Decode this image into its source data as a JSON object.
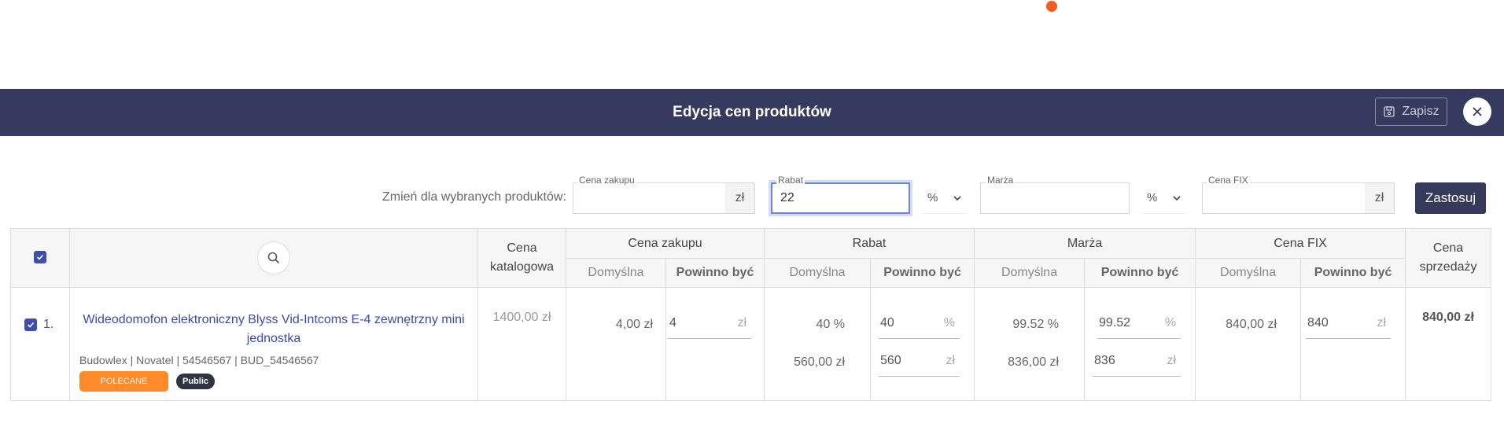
{
  "header": {
    "title": "Edycja cen produktów",
    "save_label": "Zapisz"
  },
  "filters": {
    "label": "Zmień dla wybranych produktów:",
    "purchase": {
      "label": "Cena zakupu",
      "value": "",
      "suffix": "zł"
    },
    "discount": {
      "label": "Rabat",
      "value": "22",
      "unit": "%"
    },
    "margin": {
      "label": "Marża",
      "value": "",
      "unit": "%"
    },
    "fix": {
      "label": "Cena FIX",
      "value": "",
      "suffix": "zł"
    },
    "apply_label": "Zastosuj"
  },
  "table": {
    "headers": {
      "catalog": "Cena katalogowa",
      "purchase": "Cena zakupu",
      "discount": "Rabat",
      "margin": "Marża",
      "fix": "Cena FIX",
      "sale": "Cena sprzedaży",
      "default": "Domyślna",
      "should_be": "Powinno być"
    },
    "row": {
      "index": "1.",
      "name": "Wideodomofon elektroniczny Blyss Vid-Intcoms E-4 zewnętrzny mini jednostka",
      "meta": "Budowlex | Novatel | 54546567 | BUD_54546567",
      "tag_recommended": "POLECANE",
      "tag_public": "Public",
      "catalog_price": "1400,00 zł",
      "purchase_default": "4,00 zł",
      "purchase_value": "4",
      "purchase_unit": "zł",
      "discount_default_pct": "40 %",
      "discount_value_pct": "40",
      "discount_default_amt": "560,00 zł",
      "discount_value_amt": "560",
      "margin_default_pct": "99.52 %",
      "margin_value_pct": "99.52",
      "margin_default_amt": "836,00 zł",
      "margin_value_amt": "836",
      "fix_default": "840,00 zł",
      "fix_value": "840",
      "sale_price": "840,00 zł",
      "pct_unit": "%",
      "amt_unit": "zł"
    }
  }
}
